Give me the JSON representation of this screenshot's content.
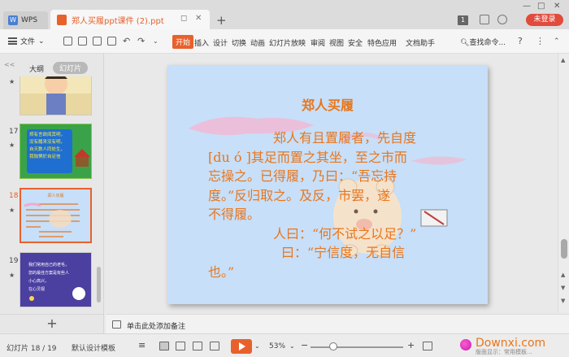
{
  "titlebar": {
    "app_tab": "WPS",
    "doc_tab": "郑人买履ppt课件 (2).ppt",
    "badge": "1",
    "login": "未登录",
    "new_tab": "+"
  },
  "ribbon": {
    "file_menu": "文件",
    "tabs": [
      "开始",
      "插入",
      "设计",
      "切换",
      "动画",
      "幻灯片放映",
      "审阅",
      "视图",
      "安全",
      "特色应用",
      "文档助手"
    ],
    "active_tab": "开始",
    "search": "查找命令...",
    "help": "?"
  },
  "left_panel": {
    "outline_tab": "大纲",
    "slides_tab": "幻灯片",
    "collapse": "<<",
    "thumbs": [
      {
        "num": "",
        "current": false
      },
      {
        "num": "17",
        "current": false,
        "text": [
          "郑有言欲闻其明，",
          "没有履来没有明，",
          "自天数人同处生，",
          "我独惧於自足信"
        ]
      },
      {
        "num": "18",
        "current": true,
        "text": [
          "郑人买履"
        ]
      },
      {
        "num": "19",
        "current": false,
        "text": [
          "我们常用自己的老毛，",
          "您的最佳方案是有些人",
          "小心高兴，",
          "在心灵视"
        ]
      }
    ],
    "add": "+"
  },
  "slide": {
    "title": "郑人买履",
    "lines": [
      "郑人有且置履者，先自度",
      "[du ó ]其足而置之其坐，至之市而",
      "忘操之。已得履，乃曰：“吾忘持",
      "度。”反归取之。及反，市罢，遂",
      "不得履。",
      "人曰：“何不试之以足？”",
      "曰：“宁信度，无自信",
      "也。”"
    ]
  },
  "notes": {
    "placeholder": "单击此处添加备注"
  },
  "statusbar": {
    "slide_info": "幻灯片 18 / 19",
    "template": "默认设计模板",
    "zoom": "53%",
    "zoom_minus": "−",
    "zoom_plus": "+",
    "brand": "Downxi.com",
    "status_text": "版面显示：常用模板..."
  },
  "colors": {
    "accent": "#e8612c",
    "slide_bg": "#c7dff8",
    "slide_text": "#e8761c"
  }
}
